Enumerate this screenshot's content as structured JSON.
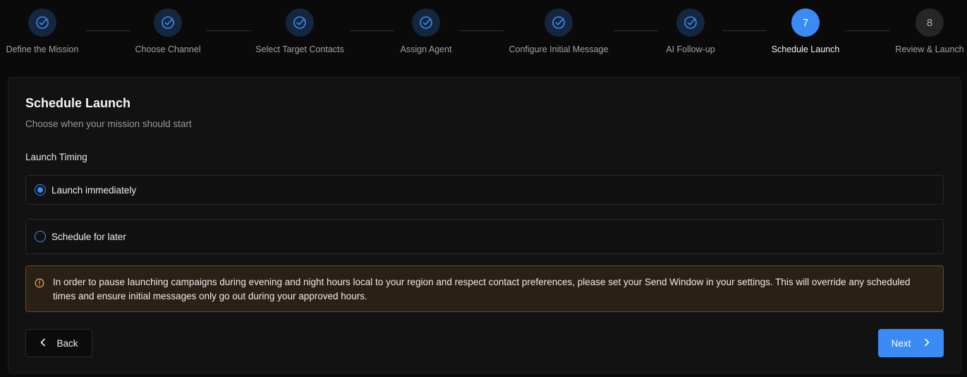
{
  "stepper": {
    "steps": [
      {
        "label": "Define the Mission",
        "status": "done",
        "icon": "check-circle-icon"
      },
      {
        "label": "Choose Channel",
        "status": "done",
        "icon": "check-circle-icon"
      },
      {
        "label": "Select Target Contacts",
        "status": "done",
        "icon": "check-circle-icon"
      },
      {
        "label": "Assign Agent",
        "status": "done",
        "icon": "check-circle-icon"
      },
      {
        "label": "Configure Initial Message",
        "status": "done",
        "icon": "check-circle-icon"
      },
      {
        "label": "AI Follow-up",
        "status": "done",
        "icon": "check-circle-icon"
      },
      {
        "label": "Schedule Launch",
        "status": "active",
        "number": "7"
      },
      {
        "label": "Review & Launch",
        "status": "pending",
        "number": "8"
      }
    ]
  },
  "card": {
    "title": "Schedule Launch",
    "subtitle": "Choose when your mission should start",
    "section_label": "Launch Timing",
    "options": [
      {
        "label": "Launch immediately",
        "selected": true
      },
      {
        "label": "Schedule for later",
        "selected": false
      }
    ],
    "alert": {
      "icon": "warning-circle-icon",
      "text": "In order to pause launching campaigns during evening and night hours local to your region and respect contact preferences, please set your Send Window in your settings. This will override any scheduled times and ensure initial messages only go out during your approved hours."
    }
  },
  "footer": {
    "back_label": "Back",
    "next_label": "Next"
  },
  "colors": {
    "accent": "#3b8bf5",
    "warning": "#e8a33a",
    "background": "#0a0a0a"
  }
}
